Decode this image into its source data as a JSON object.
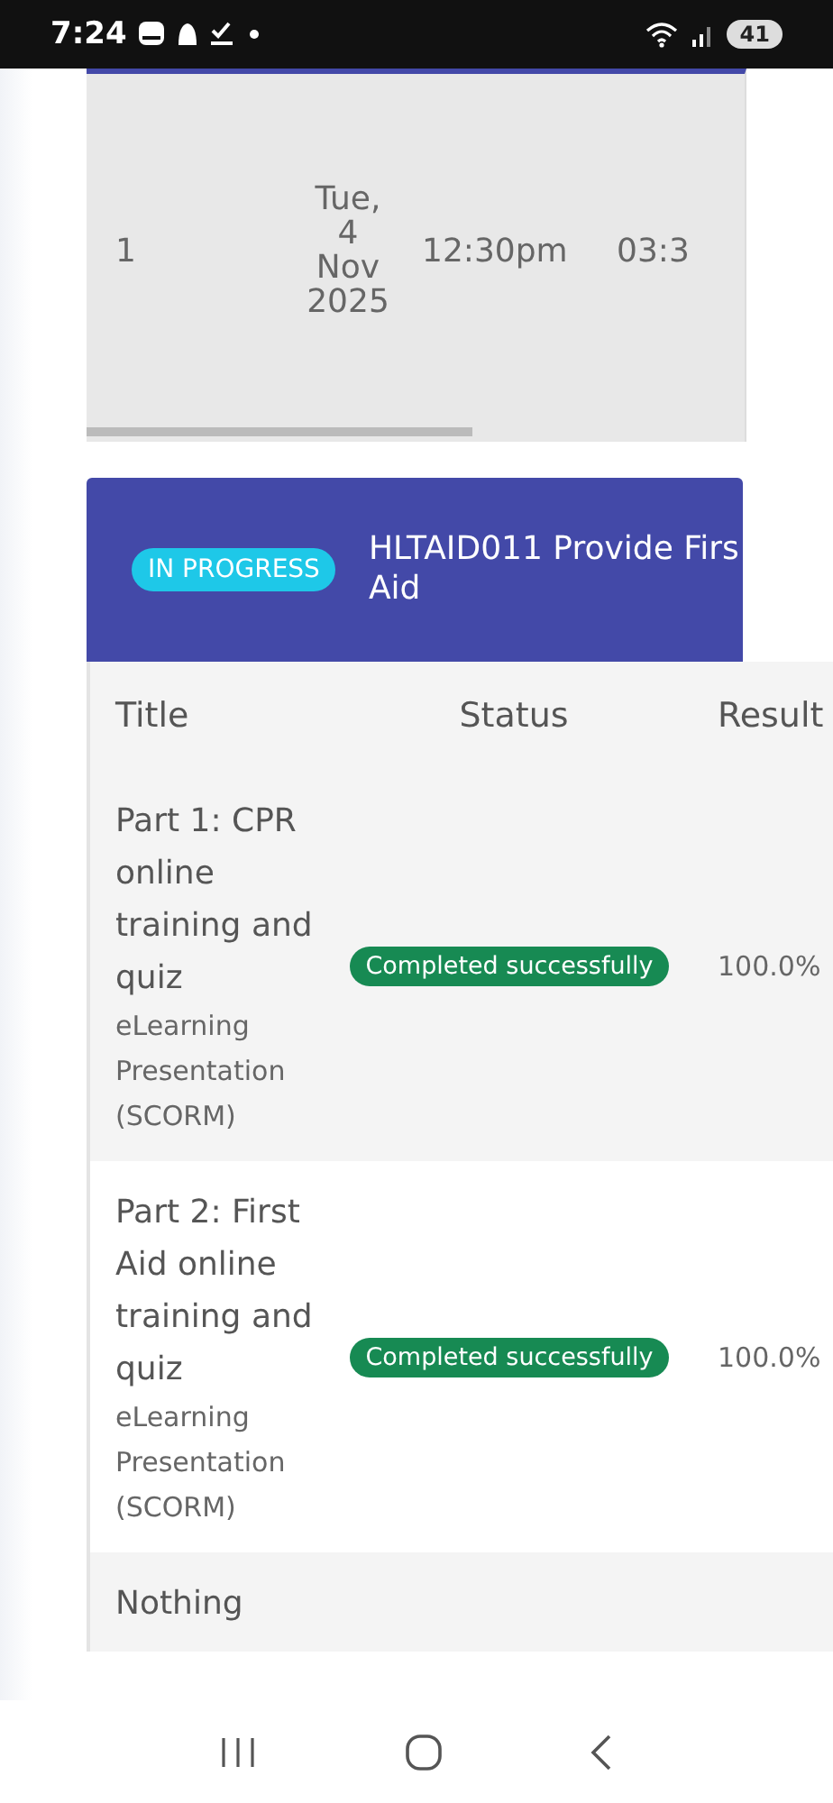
{
  "status_bar": {
    "time": "7:24",
    "battery": "41"
  },
  "session_table": {
    "rows": [
      {
        "number": "1",
        "date": "Tue, 4 Nov 2025",
        "start": "12:30pm",
        "end": "03:3"
      }
    ]
  },
  "course_card": {
    "badge": "IN PROGRESS",
    "title_lines": [
      "HLTAID011 Provide Firs",
      "Aid"
    ]
  },
  "activities": {
    "columns": [
      "Title",
      "Status",
      "Result"
    ],
    "rows": [
      {
        "title": "Part 1: CPR online training and quiz",
        "type": "eLearning Presentation (SCORM)",
        "status": "Completed successfully",
        "result": "100.0%"
      },
      {
        "title": "Part 2: First Aid online training and quiz",
        "type": "eLearning Presentation (SCORM)",
        "status": "Completed successfully",
        "result": "100.0%"
      },
      {
        "title": "Nothing"
      }
    ]
  }
}
